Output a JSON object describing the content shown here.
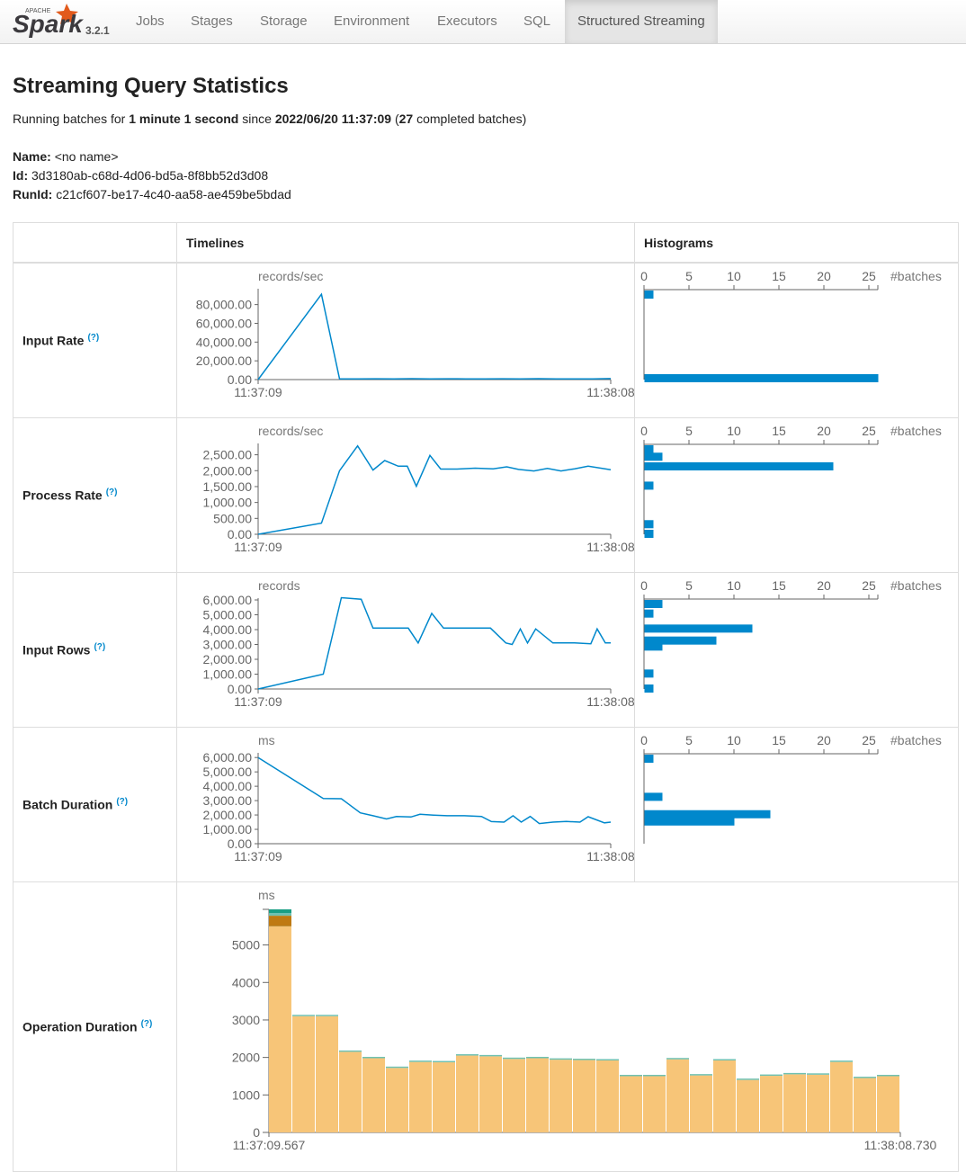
{
  "nav": {
    "logo_top": "APACHE",
    "logo_text": "Spark",
    "version": "3.2.1",
    "tabs": [
      "Jobs",
      "Stages",
      "Storage",
      "Environment",
      "Executors",
      "SQL",
      "Structured Streaming"
    ],
    "active_tab": "Structured Streaming"
  },
  "page": {
    "title": "Streaming Query Statistics",
    "summary_prefix": "Running batches for ",
    "summary_duration": "1 minute 1 second",
    "summary_since": " since ",
    "summary_start": "2022/06/20 11:37:09",
    "summary_open": " (",
    "summary_count": "27",
    "summary_suffix": " completed batches)",
    "name_label": "Name:",
    "name_value": "<no name>",
    "id_label": "Id:",
    "id_value": "3d3180ab-c68d-4d06-bd5a-8f8bb52d3d08",
    "runid_label": "RunId:",
    "runid_value": "c21cf607-be17-4c40-aa58-ae459be5bdad"
  },
  "table": {
    "col_timelines": "Timelines",
    "col_histograms": "Histograms",
    "help_mark": "(?)",
    "rows": [
      "Input Rate",
      "Process Rate",
      "Input Rows",
      "Batch Duration",
      "Operation Duration"
    ]
  },
  "colors": {
    "line": "#0088cc",
    "bar_main": "#f7c578",
    "bar_orange": "#f39c12",
    "bar_brown": "#bf7a12",
    "bar_teal_light": "#6fc1b1",
    "bar_teal": "#1a9e84"
  },
  "chart_data": [
    {
      "type": "line",
      "title": "Input Rate",
      "ylabel": "records/sec",
      "ylim": [
        0,
        95000
      ],
      "yticks": [
        "80,000.00",
        "60,000.00",
        "40,000.00",
        "20,000.00",
        "0.00"
      ],
      "xticks": [
        "11:37:09",
        "11:38:08"
      ],
      "x": [
        0,
        7,
        9,
        11,
        13,
        15,
        17,
        19,
        21,
        23,
        25,
        27,
        29,
        31,
        33,
        35,
        37,
        39
      ],
      "values": [
        0,
        91000,
        800,
        800,
        900,
        800,
        1000,
        800,
        900,
        800,
        800,
        900,
        700,
        1000,
        700,
        800,
        800,
        1100
      ],
      "hist_xticks": [
        "0",
        "5",
        "10",
        "15",
        "20",
        "25"
      ],
      "hist_label": "#batches",
      "hist": [
        {
          "v": 90000,
          "n": 1
        },
        {
          "v": 1000,
          "n": 26
        }
      ]
    },
    {
      "type": "line",
      "title": "Process Rate",
      "ylabel": "records/sec",
      "ylim": [
        0,
        2800
      ],
      "yticks": [
        "2,500.00",
        "2,000.00",
        "1,500.00",
        "1,000.00",
        "500.00",
        "0.00"
      ],
      "xticks": [
        "11:37:09",
        "11:38:08"
      ],
      "x": [
        0,
        7,
        9,
        11,
        12.7,
        14,
        15.5,
        16.5,
        17.5,
        19,
        20.2,
        22,
        24,
        26,
        27.5,
        28.8,
        30.5,
        32,
        33.5,
        35,
        36.5,
        39
      ],
      "values": [
        0,
        350,
        2000,
        2780,
        2020,
        2320,
        2140,
        2140,
        1510,
        2480,
        2050,
        2050,
        2080,
        2060,
        2120,
        2040,
        1990,
        2070,
        1990,
        2060,
        2140,
        2030
      ],
      "hist_xticks": [
        "0",
        "5",
        "10",
        "15",
        "20",
        "25"
      ],
      "hist_label": "#batches",
      "hist": [
        {
          "v": 2700,
          "n": 1
        },
        {
          "v": 2400,
          "n": 2
        },
        {
          "v": 2100,
          "n": 21
        },
        {
          "v": 1500,
          "n": 1
        },
        {
          "v": 300,
          "n": 1
        },
        {
          "v": 0,
          "n": 1
        }
      ]
    },
    {
      "type": "line",
      "title": "Input Rows",
      "ylabel": "records",
      "ylim": [
        0,
        6000
      ],
      "yticks": [
        "6,000.00",
        "5,000.00",
        "4,000.00",
        "3,000.00",
        "2,000.00",
        "1,000.00",
        "0.00"
      ],
      "xticks": [
        "11:37:09",
        "11:38:08"
      ],
      "x": [
        0,
        7.2,
        9.2,
        11.4,
        12.7,
        16.6,
        17.7,
        19.2,
        20.5,
        22.3,
        24.5,
        25.7,
        27.4,
        28.1,
        29,
        29.8,
        30.7,
        32.6,
        35,
        36.8,
        37.5,
        38.4,
        39
      ],
      "values": [
        0,
        1000,
        6150,
        6050,
        4100,
        4100,
        3100,
        5100,
        4100,
        4100,
        4100,
        4100,
        3100,
        3000,
        4050,
        3100,
        4050,
        3100,
        3100,
        3050,
        4050,
        3100,
        3100
      ],
      "hist_xticks": [
        "0",
        "5",
        "10",
        "15",
        "20",
        "25"
      ],
      "hist_label": "#batches",
      "hist": [
        {
          "v": 6000,
          "n": 2
        },
        {
          "v": 5000,
          "n": 1
        },
        {
          "v": 4000,
          "n": 12
        },
        {
          "v": 3200,
          "n": 8
        },
        {
          "v": 2800,
          "n": 2
        },
        {
          "v": 1000,
          "n": 1
        },
        {
          "v": 0,
          "n": 1
        }
      ]
    },
    {
      "type": "line",
      "title": "Batch Duration",
      "ylabel": "ms",
      "ylim": [
        0,
        6200
      ],
      "yticks": [
        "6,000.00",
        "5,000.00",
        "4,000.00",
        "3,000.00",
        "2,000.00",
        "1,000.00",
        "0.00"
      ],
      "xticks": [
        "11:37:09",
        "11:38:08"
      ],
      "x": [
        0,
        7.2,
        9.2,
        11.3,
        12.7,
        14.2,
        15.3,
        16.9,
        17.9,
        19.4,
        20.9,
        22.8,
        24.7,
        25.8,
        27.2,
        28.2,
        29.1,
        30.1,
        31.1,
        32.6,
        34.1,
        35.6,
        36.5,
        38.3,
        39
      ],
      "values": [
        6000,
        3150,
        3130,
        2150,
        1950,
        1720,
        1890,
        1860,
        2050,
        1990,
        1950,
        1950,
        1900,
        1540,
        1500,
        1950,
        1500,
        1900,
        1400,
        1500,
        1550,
        1500,
        1880,
        1450,
        1500
      ],
      "hist_xticks": [
        "0",
        "5",
        "10",
        "15",
        "20",
        "25"
      ],
      "hist_label": "#batches",
      "hist": [
        {
          "v": 6000,
          "n": 1
        },
        {
          "v": 3200,
          "n": 2
        },
        {
          "v": 2000,
          "n": 14
        },
        {
          "v": 1500,
          "n": 10
        }
      ]
    },
    {
      "type": "bar",
      "title": "Operation Duration",
      "ylabel": "ms",
      "ylim": [
        0,
        5950
      ],
      "yticks": [
        0,
        1000,
        2000,
        3000,
        4000,
        5000
      ],
      "xticks": [
        "11:37:09.567",
        "11:38:08.730"
      ],
      "values": [
        5500,
        3100,
        3100,
        2150,
        1980,
        1720,
        1880,
        1870,
        2050,
        2030,
        1960,
        1980,
        1940,
        1930,
        1920,
        1500,
        1500,
        1950,
        1520,
        1920,
        1400,
        1510,
        1550,
        1540,
        1880,
        1450,
        1500
      ],
      "extra": [
        {
          "brown": 280,
          "teal_light": 70,
          "teal": 100
        }
      ],
      "legend": [
        "bar_teal",
        "bar_teal_light",
        "bar_brown",
        "bar_orange",
        "bar_main"
      ]
    }
  ]
}
